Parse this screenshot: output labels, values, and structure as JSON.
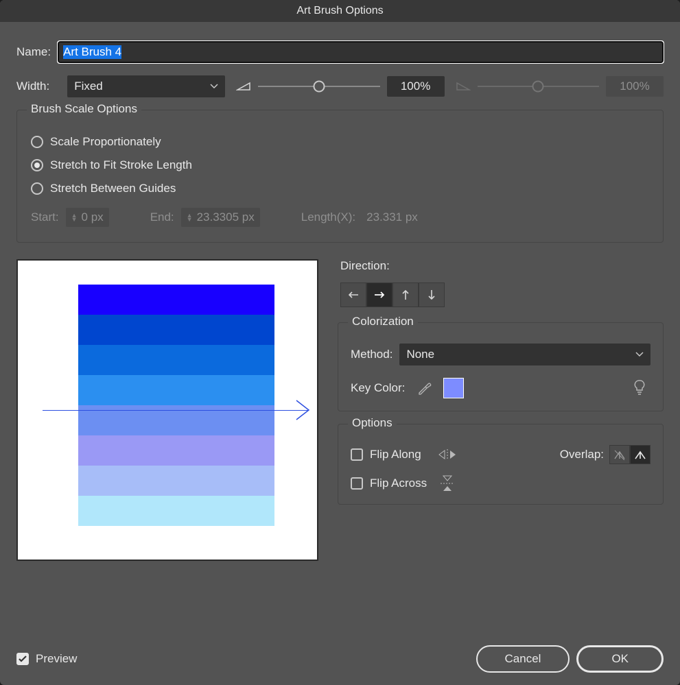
{
  "title": "Art Brush Options",
  "name": {
    "label": "Name:",
    "value": "Art Brush 4"
  },
  "width": {
    "label": "Width:",
    "select": "Fixed",
    "value1": "100%",
    "value2": "100%"
  },
  "scale": {
    "legend": "Brush Scale Options",
    "opts": [
      {
        "label": "Scale Proportionately"
      },
      {
        "label": "Stretch to Fit Stroke Length"
      },
      {
        "label": "Stretch Between Guides"
      }
    ],
    "start_label": "Start:",
    "start_value": "0 px",
    "end_label": "End:",
    "end_value": "23.3305 px",
    "length_label": "Length(X):",
    "length_value": "23.331 px"
  },
  "direction": {
    "label": "Direction:"
  },
  "colorization": {
    "legend": "Colorization",
    "method_label": "Method:",
    "method_value": "None",
    "key_label": "Key Color:",
    "key_color": "#7d8cff"
  },
  "options": {
    "legend": "Options",
    "flip_along": "Flip Along",
    "flip_across": "Flip Across",
    "overlap": "Overlap:"
  },
  "preview_label": "Preview",
  "preview_colors": [
    "#1800ff",
    "#0046cf",
    "#0b6add",
    "#2b8ff0",
    "#6c8ff2",
    "#9a99f5",
    "#a7bdf8",
    "#b1e7fb"
  ],
  "buttons": {
    "cancel": "Cancel",
    "ok": "OK"
  }
}
